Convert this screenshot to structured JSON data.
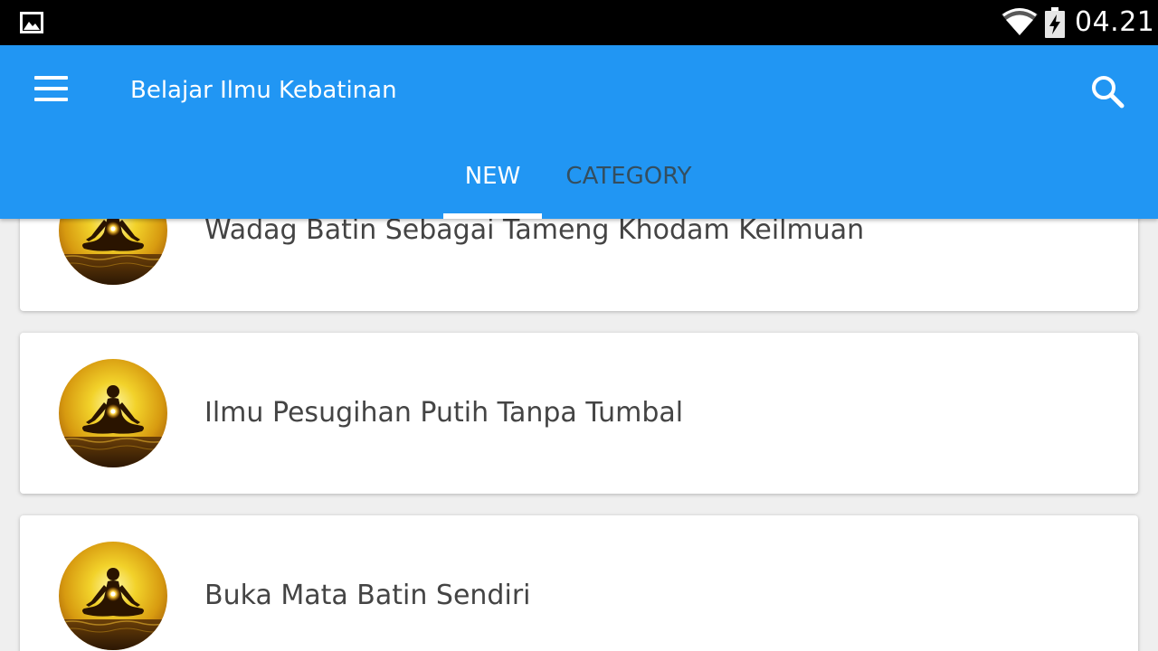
{
  "status_bar": {
    "time": "04.21",
    "left_icon": "image-icon",
    "icons": [
      "wifi-icon",
      "battery-charging-icon"
    ]
  },
  "app_bar": {
    "title": "Belajar Ilmu Kebatinan",
    "menu_icon": "menu-icon",
    "search_icon": "search-icon",
    "background_color": "#2196f3"
  },
  "tabs": [
    {
      "label": "NEW",
      "selected": true
    },
    {
      "label": "CATEGORY",
      "selected": false
    }
  ],
  "articles": [
    {
      "title": "Wadag Batin Sebagai Tameng Khodam Keilmuan",
      "thumbnail": "meditation-icon"
    },
    {
      "title": "Ilmu Pesugihan Putih Tanpa Tumbal",
      "thumbnail": "meditation-icon"
    },
    {
      "title": "Buka Mata Batin Sendiri",
      "thumbnail": "meditation-icon"
    }
  ]
}
